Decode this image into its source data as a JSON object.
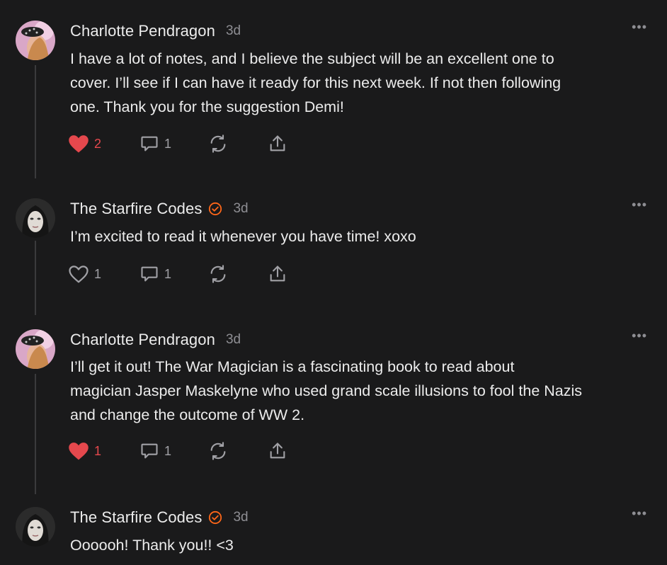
{
  "comments": [
    {
      "author": "Charlotte Pendragon",
      "verified": false,
      "time": "3d",
      "more": "•••",
      "text_lines": [
        "I have a lot of notes, and I believe the subject will be an excellent one to",
        "cover. I’ll see if I can have it ready for this next week. If not then following",
        "one. Thank you for the suggestion Demi!"
      ],
      "likes": "2",
      "liked": true,
      "replies": "1"
    },
    {
      "author": "The Starfire Codes",
      "verified": true,
      "time": "3d",
      "more": "•••",
      "text_lines": [
        "I’m excited to read it whenever you have time! xoxo"
      ],
      "likes": "1",
      "liked": false,
      "replies": "1"
    },
    {
      "author": "Charlotte Pendragon",
      "verified": false,
      "time": "3d",
      "more": "•••",
      "text_lines": [
        "I’ll get it out! The War Magician is a fascinating book to read about",
        "magician Jasper Maskelyne who used grand scale illusions to fool the Nazis",
        "and change the outcome of WW 2."
      ],
      "likes": "1",
      "liked": true,
      "replies": "1"
    },
    {
      "author": "The Starfire Codes",
      "verified": true,
      "time": "3d",
      "more": "•••",
      "text_lines": [
        "Oooooh! Thank you!! <3"
      ]
    }
  ],
  "colors": {
    "background": "#1a1a1b",
    "liked": "#e5484d",
    "verified": "#ff6719",
    "muted": "#8e8e93"
  },
  "icons": {
    "like": "heart-icon",
    "reply": "comment-bubble-icon",
    "restack": "restack-icon",
    "share": "share-icon",
    "more": "more-dots-icon",
    "verified": "verified-badge-icon"
  }
}
